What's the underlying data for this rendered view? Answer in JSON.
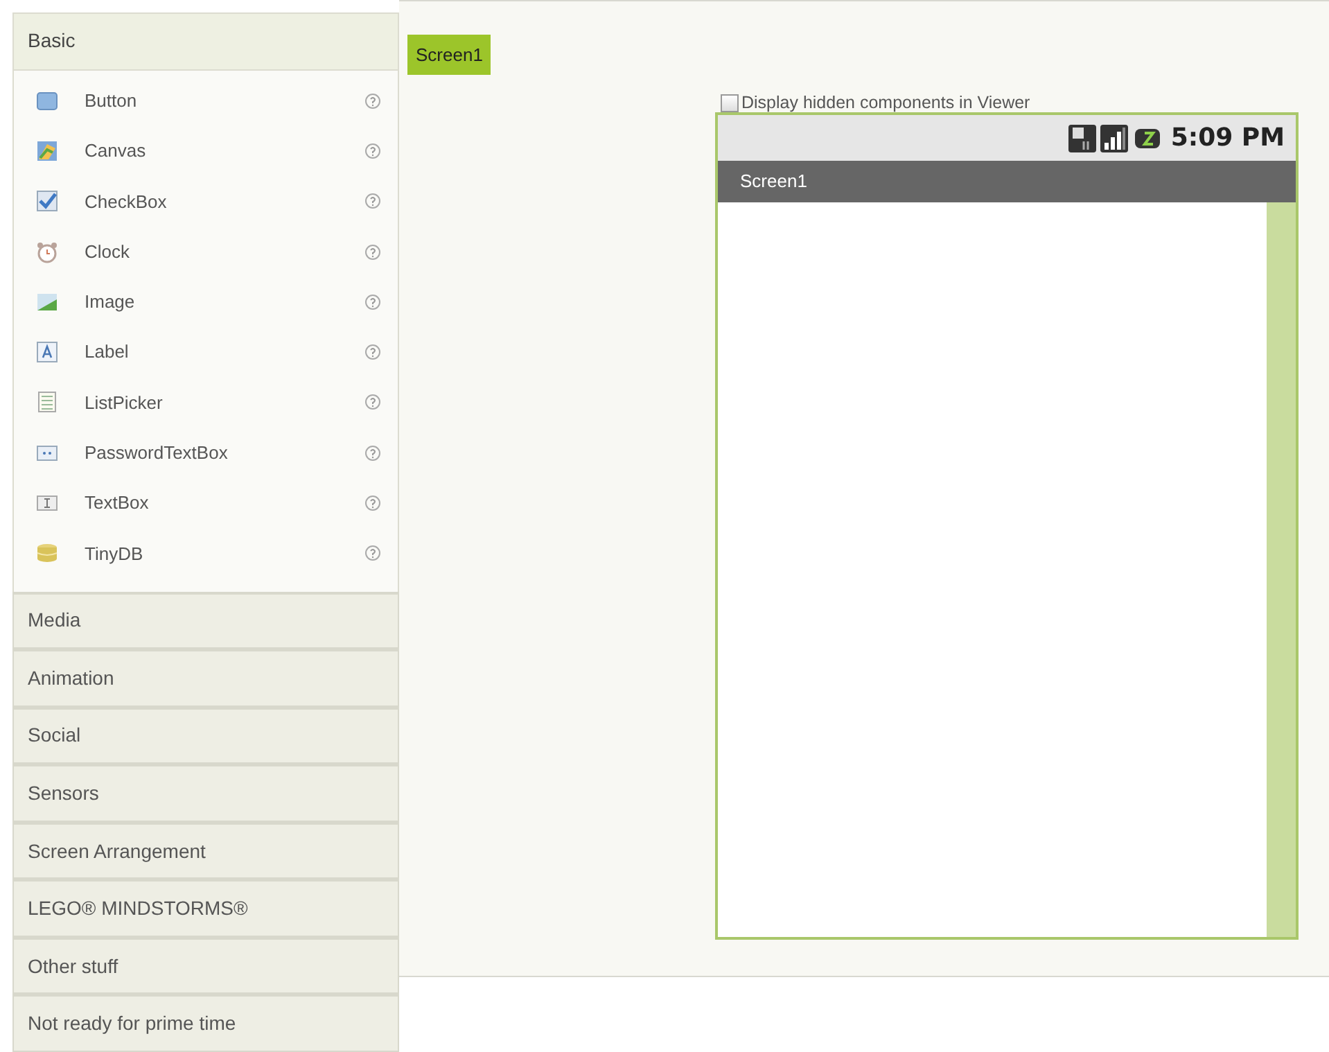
{
  "palette": {
    "categories": [
      {
        "label": "Basic",
        "expanded": true,
        "items": [
          {
            "label": "Button"
          },
          {
            "label": "Canvas"
          },
          {
            "label": "CheckBox"
          },
          {
            "label": "Clock"
          },
          {
            "label": "Image"
          },
          {
            "label": "Label"
          },
          {
            "label": "ListPicker"
          },
          {
            "label": "PasswordTextBox"
          },
          {
            "label": "TextBox"
          },
          {
            "label": "TinyDB"
          }
        ]
      },
      {
        "label": "Media",
        "expanded": false
      },
      {
        "label": "Animation",
        "expanded": false
      },
      {
        "label": "Social",
        "expanded": false
      },
      {
        "label": "Sensors",
        "expanded": false
      },
      {
        "label": "Screen Arrangement",
        "expanded": false
      },
      {
        "label": "LEGO® MINDSTORMS®",
        "expanded": false
      },
      {
        "label": "Other stuff",
        "expanded": false
      },
      {
        "label": "Not ready for prime time",
        "expanded": false
      }
    ]
  },
  "viewer": {
    "tabs": [
      {
        "label": "Screen1",
        "selected": true
      }
    ],
    "hidden_components": {
      "label": "Display hidden components in Viewer",
      "checked": false
    },
    "phone": {
      "time": "5:09 PM",
      "title": "Screen1"
    }
  }
}
